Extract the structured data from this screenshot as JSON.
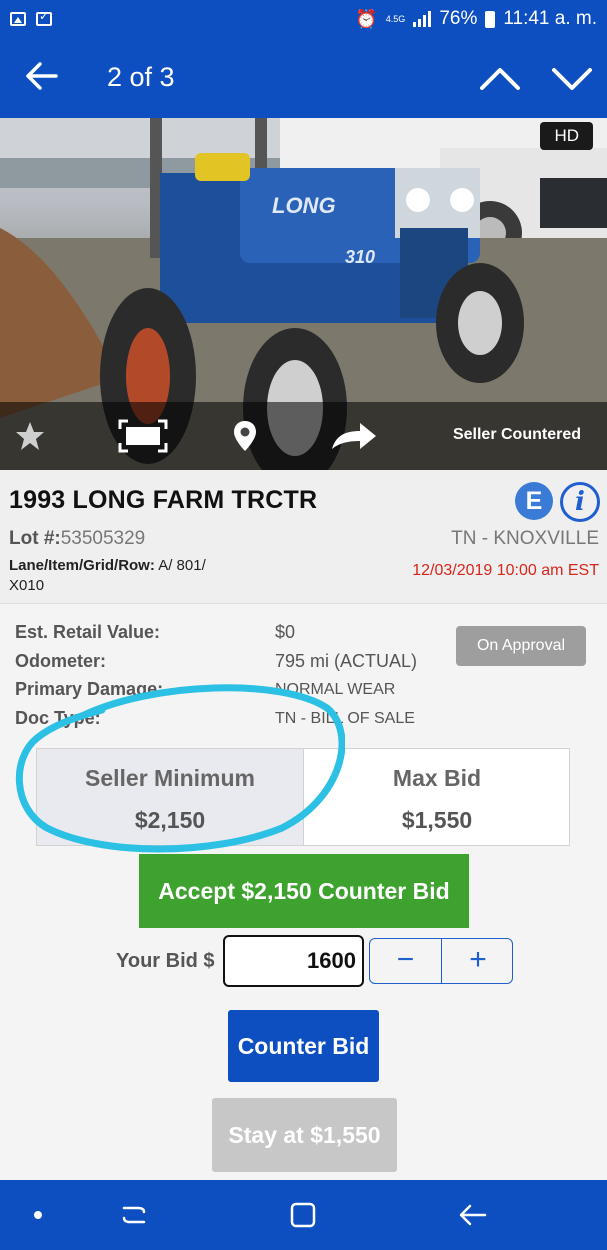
{
  "status_bar": {
    "network_label": "4.5G",
    "battery_percent": "76%",
    "time": "11:41 a. m."
  },
  "header": {
    "pager": "2 of 3"
  },
  "photo": {
    "hd_badge": "HD",
    "status_text": "Seller Countered",
    "icons": [
      "star-icon",
      "fullscreen-icon",
      "location-pin-icon",
      "share-arrow-icon"
    ]
  },
  "vehicle": {
    "title": "1993 LONG FARM TRCTR",
    "e_badge": "E",
    "info_badge": "i",
    "lot_label": "Lot #:",
    "lot_number": "53505329",
    "location": "TN - KNOXVILLE",
    "lane_label": "Lane/Item/Grid/Row:",
    "lane_value": "A/ 801/ X010",
    "sale_date": "12/03/2019 10:00 am EST"
  },
  "details": {
    "rows": [
      {
        "label": "Est. Retail Value:",
        "value": "$0"
      },
      {
        "label": "Odometer:",
        "value": "795 mi (ACTUAL)"
      },
      {
        "label": "Primary Damage:",
        "value": "NORMAL WEAR"
      },
      {
        "label": "Doc Type:",
        "value": "TN - BILL OF SALE"
      }
    ],
    "approval_badge": "On Approval"
  },
  "bid_summary": {
    "seller_min_label": "Seller Minimum",
    "seller_min_value": "$2,150",
    "max_bid_label": "Max Bid",
    "max_bid_value": "$1,550"
  },
  "actions": {
    "accept_label": "Accept $2,150 Counter Bid",
    "your_bid_label": "Your Bid",
    "currency_symbol": "$",
    "bid_value": "1600",
    "minus": "−",
    "plus": "+",
    "counter_label": "Counter Bid",
    "stay_label": "Stay at $1,550"
  },
  "colors": {
    "brand_blue": "#0d4fc1",
    "accept_green": "#3ea22f",
    "sale_date_red": "#d9261c",
    "annotation_cyan": "#2bc0e4"
  }
}
